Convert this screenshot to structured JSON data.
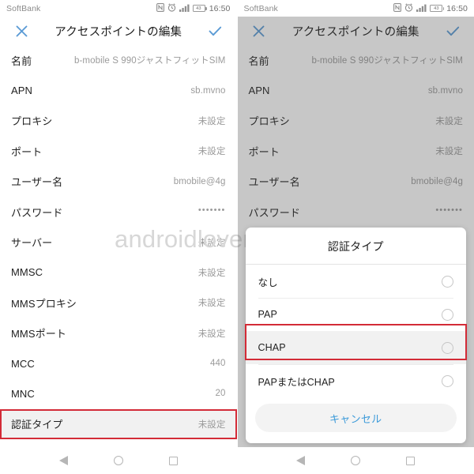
{
  "status_bar": {
    "carrier": "SoftBank",
    "time": "16:50",
    "battery_level": "43",
    "icons": [
      "nfc-icon",
      "alarm-icon",
      "signal-bars-icon",
      "battery-icon"
    ]
  },
  "app_bar": {
    "title": "アクセスポイントの編集",
    "close_icon": "close-icon",
    "confirm_icon": "check-icon",
    "accent_color": "#5b9bd5"
  },
  "watermark": {
    "text": "androidlover.net"
  },
  "settings_list": {
    "rows": [
      {
        "label": "名前",
        "value": "b-mobile S 990ジャストフィットSIM",
        "highlighted": false
      },
      {
        "label": "APN",
        "value": "sb.mvno",
        "highlighted": false
      },
      {
        "label": "プロキシ",
        "value": "未設定",
        "highlighted": false
      },
      {
        "label": "ポート",
        "value": "未設定",
        "highlighted": false
      },
      {
        "label": "ユーザー名",
        "value": "bmobile@4g",
        "highlighted": false
      },
      {
        "label": "パスワード",
        "value": "•••••••",
        "highlighted": false
      },
      {
        "label": "サーバー",
        "value": "未設定",
        "highlighted": false
      },
      {
        "label": "MMSC",
        "value": "未設定",
        "highlighted": false
      },
      {
        "label": "MMSプロキシ",
        "value": "未設定",
        "highlighted": false
      },
      {
        "label": "MMSポート",
        "value": "未設定",
        "highlighted": false
      },
      {
        "label": "MCC",
        "value": "440",
        "highlighted": false
      },
      {
        "label": "MNC",
        "value": "20",
        "highlighted": false
      },
      {
        "label": "認証タイプ",
        "value": "未設定",
        "highlighted": true
      }
    ]
  },
  "dialog": {
    "title": "認証タイプ",
    "options": [
      {
        "label": "なし",
        "selected": false,
        "highlighted": false
      },
      {
        "label": "PAP",
        "selected": false,
        "highlighted": false
      },
      {
        "label": "CHAP",
        "selected": false,
        "highlighted": true
      },
      {
        "label": "PAPまたはCHAP",
        "selected": false,
        "highlighted": false
      }
    ],
    "cancel_label": "キャンセル",
    "cancel_color": "#3b9ad9"
  },
  "nav_bar": {
    "back": "back-triangle-icon",
    "home": "home-circle-icon",
    "recents": "recents-square-icon"
  },
  "highlight_color": "#d32b37"
}
